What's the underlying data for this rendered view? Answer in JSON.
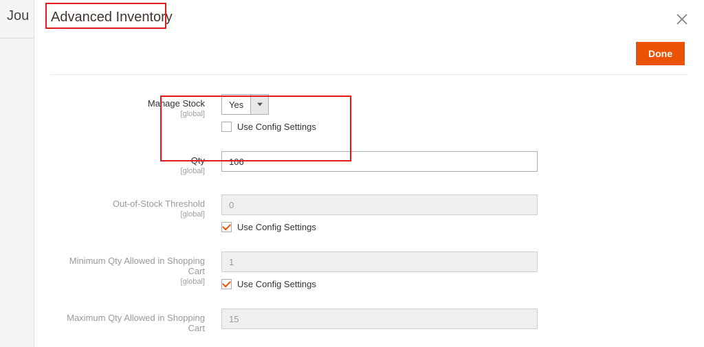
{
  "backdrop": {
    "page_title_fragment": "Jou"
  },
  "modal": {
    "title": "Advanced Inventory",
    "done_label": "Done"
  },
  "fields": {
    "manage_stock": {
      "label": "Manage Stock",
      "scope": "[global]",
      "value": "Yes",
      "use_config_label": "Use Config Settings",
      "use_config_checked": false
    },
    "qty": {
      "label": "Qty",
      "scope": "[global]",
      "value": "106"
    },
    "out_of_stock_threshold": {
      "label": "Out-of-Stock Threshold",
      "scope": "[global]",
      "value": "0",
      "use_config_label": "Use Config Settings",
      "use_config_checked": true
    },
    "min_qty_cart": {
      "label": "Minimum Qty Allowed in Shopping Cart",
      "scope": "[global]",
      "value": "1",
      "use_config_label": "Use Config Settings",
      "use_config_checked": true
    },
    "max_qty_cart": {
      "label": "Maximum Qty Allowed in Shopping Cart",
      "value": "15"
    }
  }
}
